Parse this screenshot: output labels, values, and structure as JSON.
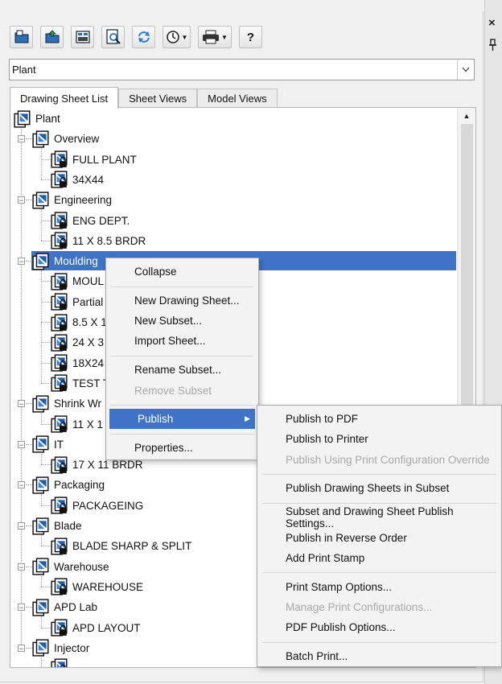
{
  "window": {
    "close_glyph": "×",
    "pin_glyph": "⊥"
  },
  "toolbar": {
    "buttons": [
      {
        "name": "new-sheet-set-icon"
      },
      {
        "name": "open-sheet-set-icon"
      },
      {
        "name": "sheet-list-table-icon"
      },
      {
        "name": "preview-icon"
      },
      {
        "name": "refresh-icon"
      },
      {
        "name": "history-icon",
        "dropdown": true
      },
      {
        "name": "printer-icon",
        "dropdown": true
      },
      {
        "name": "help-icon",
        "label": "?"
      }
    ]
  },
  "combo": {
    "value": "Plant"
  },
  "tabs": [
    "Drawing Sheet List",
    "Sheet Views",
    "Model Views"
  ],
  "tree": {
    "root": "Plant",
    "groups": [
      {
        "label": "Overview",
        "sheets": [
          "FULL PLANT",
          "34X44"
        ]
      },
      {
        "label": "Engineering",
        "sheets": [
          "ENG DEPT.",
          "11 X 8.5 BRDR"
        ]
      },
      {
        "label": "Moulding",
        "selected": true,
        "sheets": [
          "MOUL",
          "Partial",
          "8.5 X 1",
          "24 X 3",
          "18X24",
          "TEST T"
        ]
      },
      {
        "label": "Shrink Wr",
        "sheets": [
          "11 X 1"
        ]
      },
      {
        "label": "IT",
        "sheets": [
          "17 X 11 BRDR"
        ]
      },
      {
        "label": "Packaging",
        "sheets": [
          "PACKAGEING"
        ]
      },
      {
        "label": "Blade",
        "sheets": [
          "BLADE SHARP & SPLIT"
        ]
      },
      {
        "label": "Warehouse",
        "sheets": [
          "WAREHOUSE"
        ]
      },
      {
        "label": "APD Lab",
        "sheets": [
          "APD LAYOUT"
        ]
      },
      {
        "label": "Injector",
        "sheets": []
      }
    ]
  },
  "context_menu": {
    "items": [
      {
        "label": "Collapse"
      },
      {
        "sep": true
      },
      {
        "label": "New Drawing Sheet..."
      },
      {
        "label": "New Subset..."
      },
      {
        "label": "Import Sheet..."
      },
      {
        "sep": true
      },
      {
        "label": "Rename Subset..."
      },
      {
        "label": "Remove Subset",
        "disabled": true
      },
      {
        "sep": true
      },
      {
        "label": "Publish",
        "submenu": true,
        "hover": true
      },
      {
        "sep": true
      },
      {
        "label": "Properties..."
      }
    ]
  },
  "publish_submenu": {
    "items": [
      {
        "label": "Publish to PDF"
      },
      {
        "label": "Publish to Printer"
      },
      {
        "label": "Publish Using Print Configuration Override",
        "disabled": true
      },
      {
        "sep": true
      },
      {
        "label": "Publish Drawing Sheets in Subset"
      },
      {
        "sep": true
      },
      {
        "label": "Subset and Drawing Sheet Publish Settings..."
      },
      {
        "label": "Publish in Reverse Order"
      },
      {
        "label": "Add Print Stamp"
      },
      {
        "sep": true
      },
      {
        "label": "Print Stamp Options..."
      },
      {
        "label": "Manage Print Configurations...",
        "disabled": true
      },
      {
        "label": "PDF Publish Options..."
      },
      {
        "sep": true
      },
      {
        "label": "Batch Print..."
      }
    ]
  },
  "colors": {
    "selection": "#3f73c8",
    "icon_blue": "#1b5eab"
  }
}
